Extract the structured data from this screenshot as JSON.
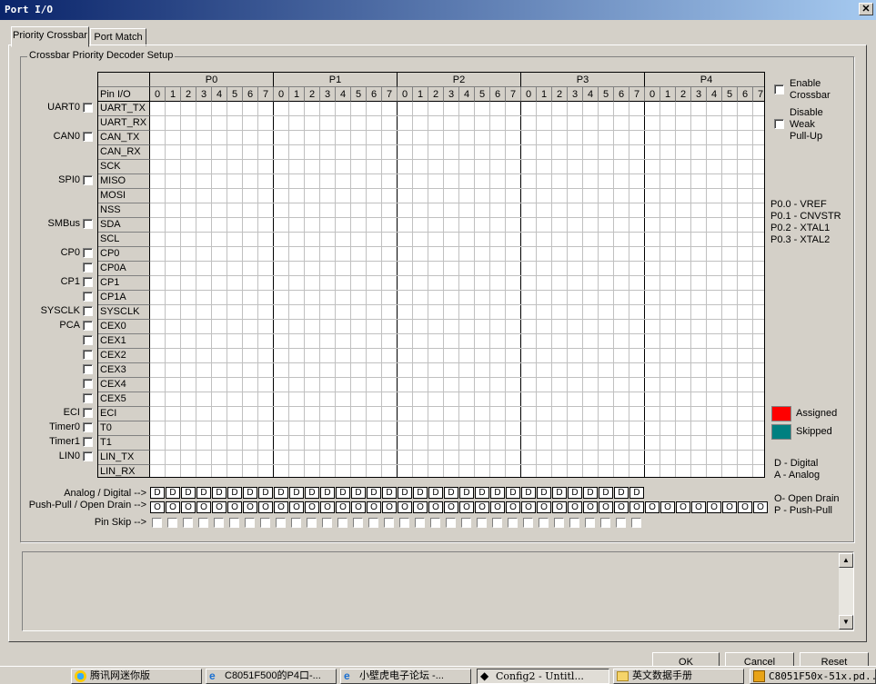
{
  "window": {
    "title": "Port I/O",
    "close_glyph": "✕"
  },
  "tabs": [
    {
      "label": "Priority Crossbar",
      "active": true
    },
    {
      "label": "Port Match",
      "active": false
    }
  ],
  "group_title": "Crossbar Priority Decoder Setup",
  "left_checks": [
    {
      "label": "UART0",
      "row": 0
    },
    {
      "label": "CAN0",
      "row": 2
    },
    {
      "label": "SPI0",
      "row": 5
    },
    {
      "label": "SMBus",
      "row": 8
    },
    {
      "label": "CP0",
      "row": 10
    },
    {
      "label": "",
      "row": 11
    },
    {
      "label": "CP1",
      "row": 12
    },
    {
      "label": "",
      "row": 13
    },
    {
      "label": "SYSCLK",
      "row": 14
    },
    {
      "label": "PCA",
      "row": 15
    },
    {
      "label": "",
      "row": 16
    },
    {
      "label": "",
      "row": 17
    },
    {
      "label": "",
      "row": 18
    },
    {
      "label": "",
      "row": 19
    },
    {
      "label": "",
      "row": 20
    },
    {
      "label": "ECI",
      "row": 21
    },
    {
      "label": "Timer0",
      "row": 22
    },
    {
      "label": "Timer1",
      "row": 23
    },
    {
      "label": "LIN0",
      "row": 24
    }
  ],
  "grid": {
    "pin_io_label": "Pin I/O",
    "ports": [
      "P0",
      "P1",
      "P2",
      "P3",
      "P4"
    ],
    "bits": [
      "0",
      "1",
      "2",
      "3",
      "4",
      "5",
      "6",
      "7"
    ],
    "rows": [
      "UART_TX",
      "UART_RX",
      "CAN_TX",
      "CAN_RX",
      "SCK",
      "MISO",
      "MOSI",
      "NSS",
      "SDA",
      "SCL",
      "CP0",
      "CP0A",
      "CP1",
      "CP1A",
      "SYSCLK",
      "CEX0",
      "CEX1",
      "CEX2",
      "CEX3",
      "CEX4",
      "CEX5",
      "ECI",
      "T0",
      "T1",
      "LIN_TX",
      "LIN_RX"
    ]
  },
  "bottom": {
    "analog_label": "Analog / Digital -->",
    "pushpull_label": "Push-Pull / Open Drain -->",
    "skip_label": "Pin Skip -->",
    "analog_value": "D",
    "pushpull_value": "O",
    "analog_ports": 4,
    "pushpull_ports": 5,
    "skip_ports": 4
  },
  "right": {
    "enable_crossbar": "Enable\nCrossbar",
    "disable_pullup": "Disable\nWeak\nPull-Up",
    "pin_notes": [
      "P0.0 - VREF",
      "P0.1 - CNVSTR",
      "P0.2 - XTAL1",
      "P0.3 - XTAL2"
    ],
    "legend": [
      {
        "label": "Assigned",
        "color": "#ff0000"
      },
      {
        "label": "Skipped",
        "color": "#008080"
      }
    ],
    "digital_note": "D - Digital",
    "analog_note": "A - Analog",
    "open_drain_note": "O- Open Drain",
    "push_pull_note": "P - Push-Pull"
  },
  "buttons": {
    "ok": "OK",
    "cancel": "Cancel",
    "reset": "Reset"
  },
  "taskbar": [
    {
      "label": "腾讯网迷你版",
      "icon": "browser-icon",
      "pressed": false
    },
    {
      "label": "C8051F500的P4口-...",
      "icon": "ie-icon",
      "pressed": false
    },
    {
      "label": "小壁虎电子论坛 -...",
      "icon": "ie-icon",
      "pressed": false
    },
    {
      "label": "Config2 - Untitl...",
      "icon": "config-icon",
      "pressed": true
    },
    {
      "label": "英文数据手册",
      "icon": "folder-icon",
      "pressed": false
    },
    {
      "label": "C8051F50x-51x.pd...",
      "icon": "pdf-icon",
      "pressed": false
    }
  ]
}
